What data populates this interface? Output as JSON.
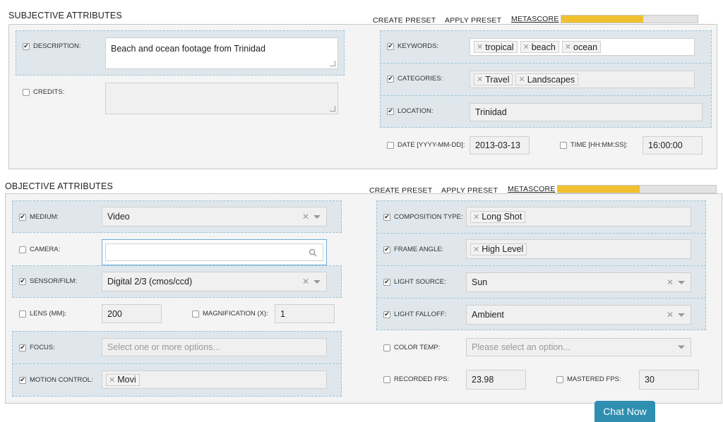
{
  "subjective": {
    "title": "SUBJECTIVE ATTRIBUTES",
    "create_preset": "CREATE PRESET",
    "apply_preset": "APPLY PRESET",
    "metascore": "METASCORE",
    "metascore_fill": 0.6,
    "description": {
      "label": "DESCRIPTION:",
      "checked": true,
      "value": "Beach and ocean footage from Trinidad"
    },
    "credits": {
      "label": "CREDITS:",
      "checked": false,
      "value": ""
    },
    "keywords": {
      "label": "KEYWORDS:",
      "checked": true,
      "tags": [
        "tropical",
        "beach",
        "ocean"
      ]
    },
    "categories": {
      "label": "CATEGORIES:",
      "checked": true,
      "tags": [
        "Travel",
        "Landscapes"
      ]
    },
    "location": {
      "label": "LOCATION:",
      "checked": true,
      "value": "Trinidad"
    },
    "date": {
      "label": "DATE [YYYY-MM-DD]:",
      "checked": false,
      "value": "2013-03-13"
    },
    "time": {
      "label": "TIME [HH:MM:SS]:",
      "checked": false,
      "value": "16:00:00"
    }
  },
  "objective": {
    "title": "OBJECTIVE ATTRIBUTES",
    "create_preset": "CREATE PRESET",
    "apply_preset": "APPLY PRESET",
    "metascore": "METASCORE",
    "metascore_fill": 0.52,
    "medium": {
      "label": "MEDIUM:",
      "checked": true,
      "value": "Video"
    },
    "camera": {
      "label": "CAMERA:",
      "checked": false,
      "value": ""
    },
    "sensor": {
      "label": "SENSOR/FILM:",
      "checked": true,
      "value": "Digital 2/3 (cmos/ccd)"
    },
    "lens": {
      "label": "LENS (MM):",
      "checked": false,
      "value": "200"
    },
    "magnification": {
      "label": "MAGNIFICATION (X):",
      "checked": false,
      "value": "1"
    },
    "focus": {
      "label": "FOCUS:",
      "checked": true,
      "placeholder": "Select one or more options..."
    },
    "motion_control": {
      "label": "MOTION CONTROL:",
      "checked": true,
      "tags": [
        "Movi"
      ]
    },
    "composition_type": {
      "label": "COMPOSITION TYPE:",
      "checked": true,
      "tags": [
        "Long Shot"
      ]
    },
    "frame_angle": {
      "label": "FRAME ANGLE:",
      "checked": true,
      "tags": [
        "High Level"
      ]
    },
    "light_source": {
      "label": "LIGHT SOURCE:",
      "checked": true,
      "value": "Sun"
    },
    "light_falloff": {
      "label": "LIGHT FALLOFF:",
      "checked": true,
      "value": "Ambient"
    },
    "color_temp": {
      "label": "COLOR TEMP:",
      "checked": false,
      "placeholder": "Please select an option..."
    },
    "recorded_fps": {
      "label": "RECORDED FPS:",
      "checked": false,
      "value": "23.98"
    },
    "mastered_fps": {
      "label": "MASTERED FPS:",
      "checked": false,
      "value": "30"
    }
  },
  "chat": {
    "label": "Chat Now"
  },
  "icons": {
    "remove": "x-icon",
    "dropdown": "chevron-down-icon",
    "search": "search-icon",
    "check": "checkbox-icon"
  },
  "colors": {
    "accent_bar": "#f0c030",
    "highlight_bg": "#dfe7ec",
    "chat_bg": "#2f8fb0"
  }
}
